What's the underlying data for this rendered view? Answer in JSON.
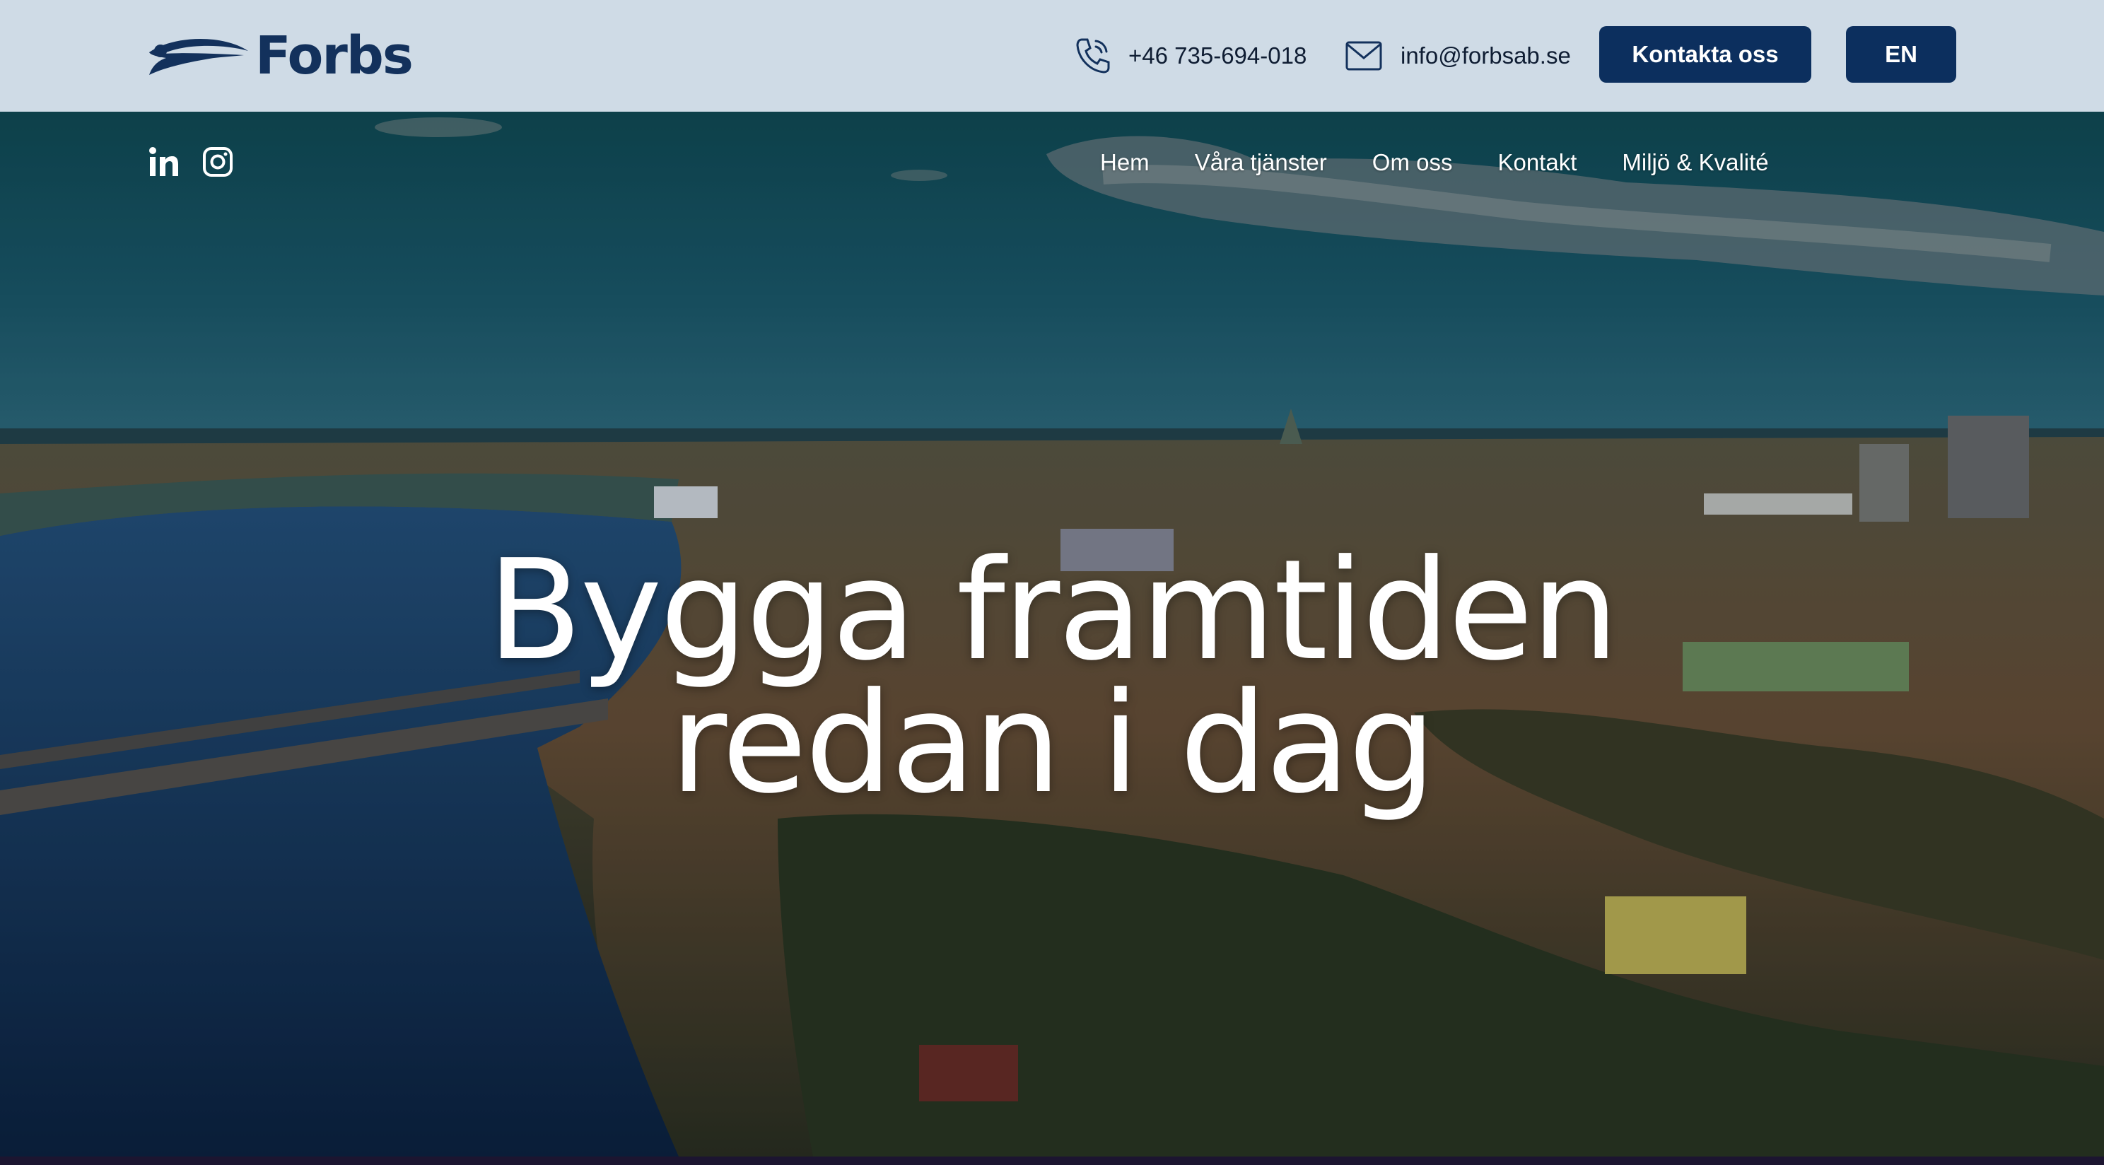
{
  "header": {
    "logo_text": "Forbs",
    "phone": "+46 735-694-018",
    "email": "info@forbsab.se",
    "contact_button": "Kontakta oss",
    "language_button": "EN"
  },
  "social": {
    "linkedin_label": "in",
    "icons": [
      "linkedin-icon",
      "instagram-icon"
    ]
  },
  "nav": {
    "items": [
      "Hem",
      "Våra tjänster",
      "Om oss",
      "Kontakt",
      "Miljö & Kvalité"
    ]
  },
  "hero": {
    "headline_line1": "Bygga framtiden",
    "headline_line2": "redan i dag"
  },
  "colors": {
    "topbar_bg": "#cfdbe6",
    "brand_navy": "#0c2f5e",
    "text_dark": "#0f1d33"
  }
}
